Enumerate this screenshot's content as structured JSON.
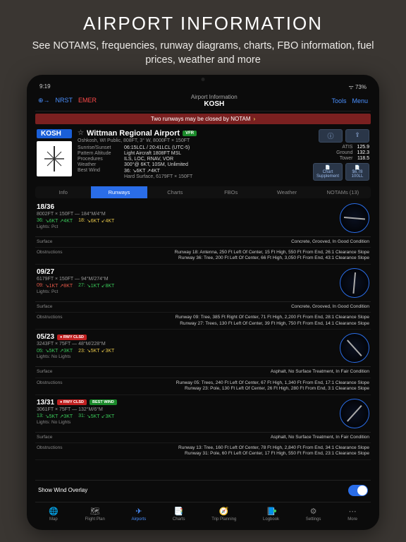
{
  "hero": {
    "title": "AIRPORT INFORMATION",
    "subtitle": "See NOTAMS, frequencies, runway diagrams, charts, FBO information, fuel prices, weather and more"
  },
  "status": {
    "time": "9:19"
  },
  "topbar": {
    "left1": "NRST",
    "left2": "EMER",
    "subtitle": "Airport Information",
    "title": "KOSH",
    "right1": "Tools",
    "right2": "Menu"
  },
  "alert": "Two runways may be closed by NOTAM",
  "airport": {
    "code": "KOSH",
    "name": "Wittman Regional Airport",
    "vfr": "VFR",
    "loc": "Oshkosh, WI  Public, 808FT, 3° W, 8000FT × 150FT",
    "kv": [
      [
        "Sunrise/Sunset",
        "06:15LCL / 20:41LCL (UTC-5)"
      ],
      [
        "Pattern Altitude",
        "Light Aircraft 1808FT MSL"
      ],
      [
        "Procedures",
        "ILS, LOC, RNAV, VOR"
      ],
      [
        "Weather",
        "300°@ 6KT, 10SM, Unlimited"
      ],
      [
        "Best Wind",
        "36: ↘6KT ↗4KT"
      ]
    ],
    "surface": "Hard Surface, 6179FT × 150FT"
  },
  "freqs": [
    [
      "ATIS",
      "125.9"
    ],
    [
      "Ground",
      "132.3"
    ],
    [
      "Tower",
      "118.5"
    ]
  ],
  "chips": [
    [
      "Chart",
      "Supplement"
    ],
    [
      "$6.78",
      "100LL"
    ]
  ],
  "tabs": [
    "Info",
    "Runways",
    "Charts",
    "FBOs",
    "Weather",
    "NOTAMs (13)"
  ],
  "runways": [
    {
      "id": "18/36",
      "dims": "8002FT × 150FT — 184°M/4°M",
      "wind1": [
        "36:",
        "↘6KT",
        "↗4KT",
        "green"
      ],
      "wind2": [
        "18:",
        "↘6KT",
        "↙4KT",
        "yellow"
      ],
      "lights": "Lights: Pct",
      "angle": 5,
      "surface": "Concrete, Grooved, In Good Condition",
      "obstructions": "Runway 18: Antenna, 250 Ft Left Of Center, 15 Ft High, 550 Ft From End, 26:1 Clearance Slope\nRunway 36: Tree, 200 Ft Left Of Center, 66 Ft High, 3,050 Ft From End, 43:1 Clearance Slope"
    },
    {
      "id": "09/27",
      "dims": "6179FT × 150FT — 94°M/274°M",
      "wind1": [
        "09:",
        "↘1KT",
        "↗8KT",
        "red"
      ],
      "wind2": [
        "27:",
        "↘1KT",
        "↙8KT",
        "green"
      ],
      "lights": "Lights: Pct",
      "angle": 95,
      "surface": "Concrete, Grooved, In Good Condition",
      "obstructions": "Runway 09: Tree, 385 Ft Right Of Center, 71 Ft High, 2,200 Ft From End, 28:1 Clearance Slope\nRunway 27: Trees, 130 Ft Left Of Center, 39 Ft High, 750 Ft From End, 14:1 Clearance Slope"
    },
    {
      "id": "05/23",
      "badge": "RWY CLSD",
      "dims": "3243FT × 75FT — 48°M/228°M",
      "wind1": [
        "05:",
        "↘5KT",
        "↗3KT",
        "green"
      ],
      "wind2": [
        "23:",
        "↘5KT",
        "↙3KT",
        "yellow"
      ],
      "lights": "Lights: No Lights",
      "angle": 48,
      "surface": "Asphalt, No Surface Treatment, In Fair Condition",
      "obstructions": "Runway 05: Trees, 240 Ft Left Of Center, 67 Ft High, 1,340 Ft From End, 17:1 Clearance Slope\nRunway 23: Pole, 130 Ft Left Of Center, 26 Ft High, 280 Ft From End, 3:1 Clearance Slope"
    },
    {
      "id": "13/31",
      "badge": "RWY CLSD",
      "badge2": "BEST WIND",
      "dims": "3061FT × 75FT — 132°M/6°M",
      "wind1": [
        "13:",
        "↘5KT",
        "↗3KT",
        "green"
      ],
      "wind2": [
        "31:",
        "↘5KT",
        "↙3KT",
        "green"
      ],
      "lights": "Lights: No Lights",
      "angle": 132,
      "surface": "Asphalt, No Surface Treatment, In Fair Condition",
      "obstructions": "Runway 13: Tree, 160 Ft Left Of Center, 78 Ft High, 2,840 Ft From End, 34:1 Clearance Slope\nRunway 31: Pole, 60 Ft Left Of Center, 17 Ft High, 550 Ft From End, 23:1 Clearance Slope"
    }
  ],
  "overlay": "Show Wind Overlay",
  "nav": [
    "Map",
    "Flight Plan",
    "Airports",
    "Charts",
    "Trip Planning",
    "Logbook",
    "Settings",
    "More"
  ]
}
